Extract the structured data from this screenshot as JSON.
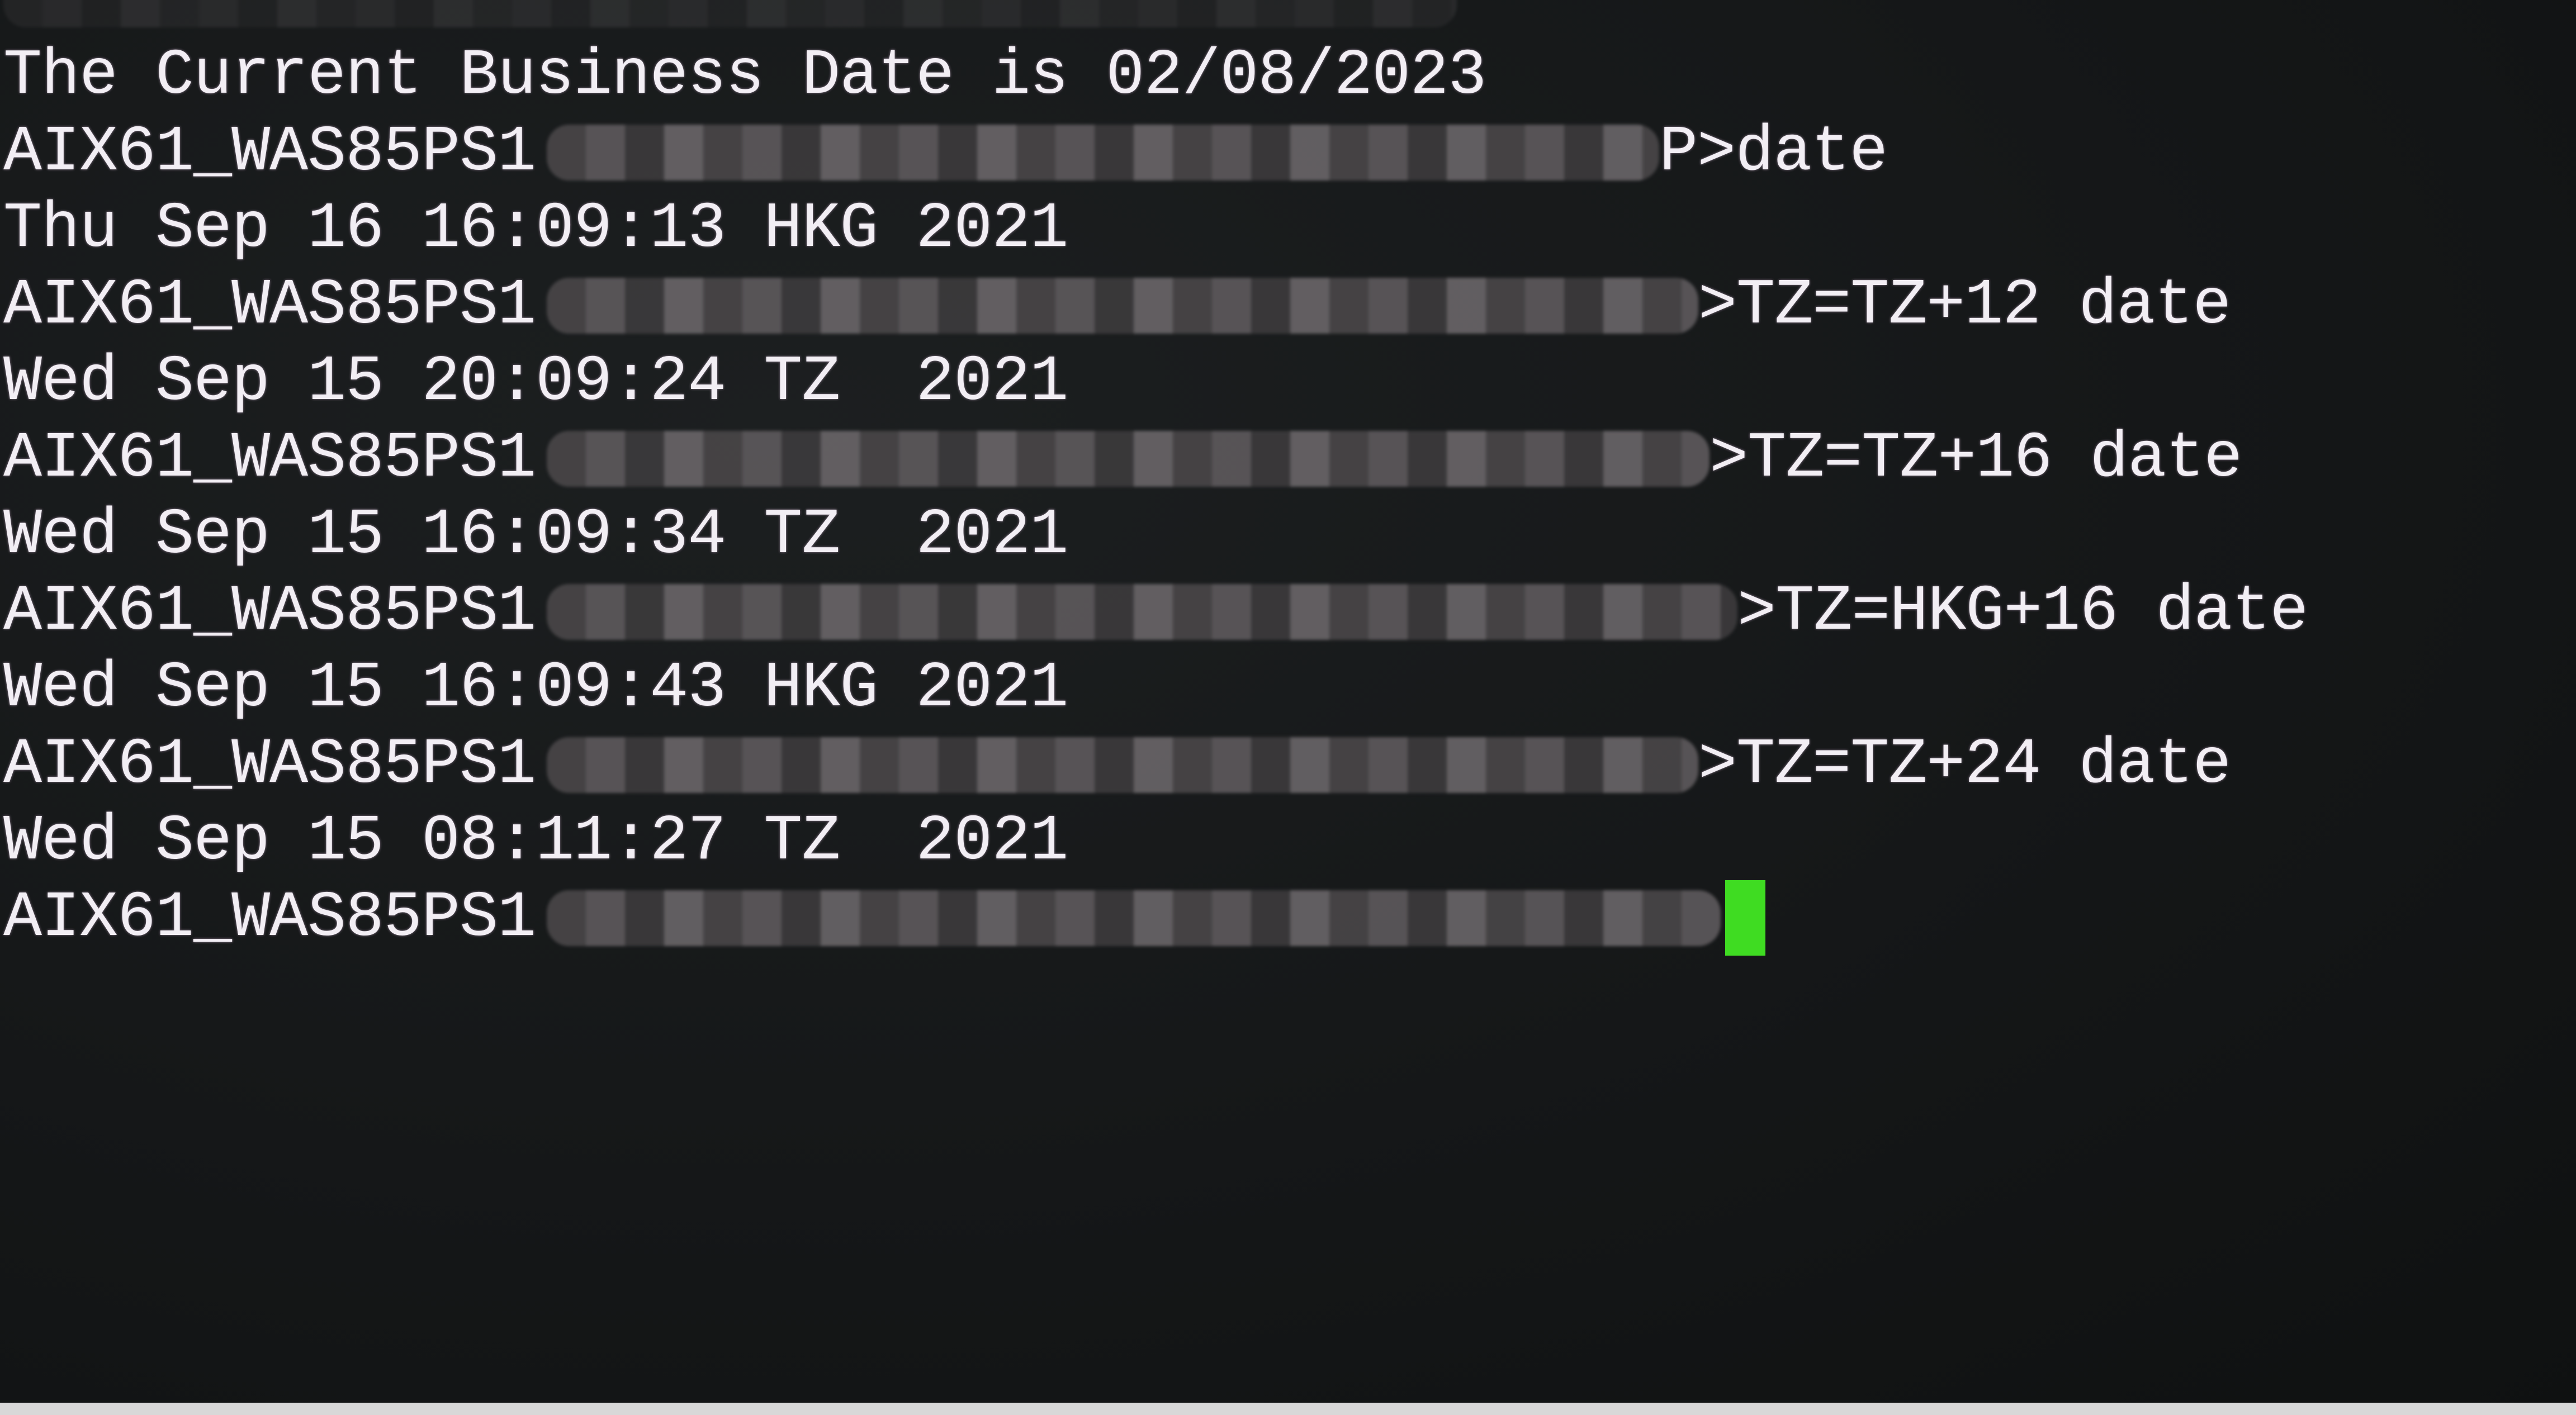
{
  "terminal": {
    "lines": [
      {
        "type": "output",
        "text": "The Current Business Date is 02/08/2023"
      },
      {
        "type": "prompt",
        "host": "AIX61_WAS85PS1",
        "command": "P>date"
      },
      {
        "type": "output",
        "text": "Thu Sep 16 16:09:13 HKG 2021"
      },
      {
        "type": "prompt",
        "host": "AIX61_WAS85PS1",
        "command": ">TZ=TZ+12 date"
      },
      {
        "type": "output",
        "text": "Wed Sep 15 20:09:24 TZ  2021"
      },
      {
        "type": "prompt",
        "host": "AIX61_WAS85PS1",
        "command": ">TZ=TZ+16 date"
      },
      {
        "type": "output",
        "text": "Wed Sep 15 16:09:34 TZ  2021"
      },
      {
        "type": "prompt",
        "host": "AIX61_WAS85PS1",
        "command": ">TZ=HKG+16 date"
      },
      {
        "type": "output",
        "text": "Wed Sep 15 16:09:43 HKG 2021"
      },
      {
        "type": "prompt",
        "host": "AIX61_WAS85PS1",
        "command": ">TZ=TZ+24 date"
      },
      {
        "type": "output",
        "text": "Wed Sep 15 08:11:27 TZ  2021"
      },
      {
        "type": "prompt",
        "host": "AIX61_WAS85PS1",
        "command": ""
      }
    ],
    "cursor_color": "#3fdc22"
  }
}
